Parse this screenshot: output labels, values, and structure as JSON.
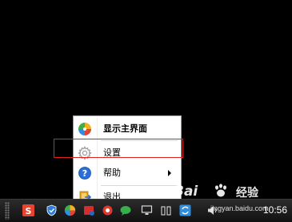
{
  "menu": {
    "items": [
      {
        "label": "显示主界面",
        "icon": "pinwheel-app-icon",
        "bold": true
      },
      {
        "label": "设置",
        "icon": "gear-icon"
      },
      {
        "label": "帮助",
        "icon": "help-icon",
        "has_submenu": true
      },
      {
        "label": "退出",
        "icon": "exit-icon"
      }
    ],
    "highlighted_item": "设置"
  },
  "taskbar": {
    "clock": "10:56",
    "tray_icons": [
      "sogou-input-icon",
      "shield-icon",
      "pinwheel-app-icon",
      "red-app-icon",
      "chat-icon",
      "monitor-icon",
      "network-icon",
      "sync-icon",
      "speaker-icon"
    ]
  },
  "watermark": {
    "logo_text": "Bai",
    "jingyan": "经验",
    "url": "jingyan.baidu.com"
  },
  "colors": {
    "background": "#000000",
    "highlight": "#e02020",
    "menu_bg": "#ffffff",
    "help_blue": "#2a6fd6"
  }
}
